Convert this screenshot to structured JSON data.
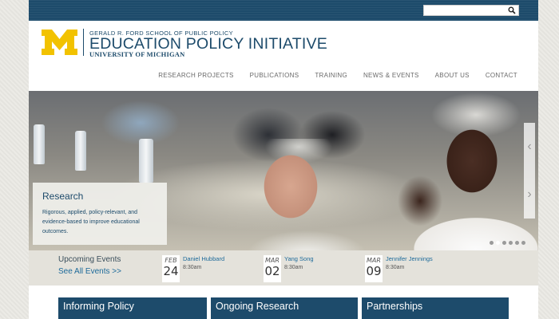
{
  "search": {
    "placeholder": ""
  },
  "logo": {
    "school": "GERALD R. FORD SCHOOL OF PUBLIC POLICY",
    "title": "EDUCATION POLICY INITIATIVE",
    "university": "UNIVERSITY OF MICHIGAN",
    "brand_color": "#f2c200",
    "text_color": "#1d4b6b"
  },
  "nav": {
    "items": [
      {
        "label": "RESEARCH PROJECTS"
      },
      {
        "label": "PUBLICATIONS"
      },
      {
        "label": "TRAINING"
      },
      {
        "label": "NEWS & EVENTS"
      },
      {
        "label": "ABOUT US"
      },
      {
        "label": "CONTACT"
      }
    ]
  },
  "hero": {
    "caption_title": "Research",
    "caption_text": "Rigorous, applied, policy-relevant, and evidence-based to improve educational outcomes.",
    "prev_icon": "chevron-left-icon",
    "next_icon": "chevron-right-icon",
    "slide_count": 6,
    "active_slide": 1
  },
  "events": {
    "title": "Upcoming Events",
    "see_all": "See All Events >>",
    "items": [
      {
        "month": "FEB",
        "day": "24",
        "name": "Daniel Hubbard",
        "time": "8:30am"
      },
      {
        "month": "MAR",
        "day": "02",
        "name": "Yang Song",
        "time": "8:30am"
      },
      {
        "month": "MAR",
        "day": "09",
        "name": "Jennifer Jennings",
        "time": "8:30am"
      }
    ]
  },
  "sections": {
    "items": [
      {
        "label": "Informing Policy"
      },
      {
        "label": "Ongoing Research"
      },
      {
        "label": "Partnerships"
      }
    ]
  },
  "colors": {
    "primary": "#1d4b6b",
    "link": "#1d6a9a",
    "accent": "#f2c200"
  }
}
